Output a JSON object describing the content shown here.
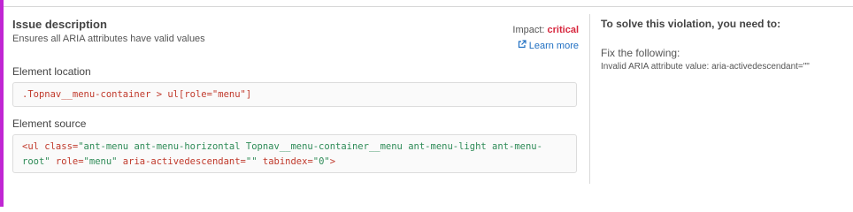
{
  "issue": {
    "title": "Issue description",
    "subtitle": "Ensures all ARIA attributes have valid values",
    "impact_label": "Impact:",
    "impact_value": "critical",
    "learn_more": "Learn more"
  },
  "location": {
    "label": "Element location",
    "selector": ".Topnav__menu-container > ul[role=\"menu\"]"
  },
  "source": {
    "label": "Element source",
    "line1": {
      "t1": "<ul",
      "t2": " class=",
      "t3": "\"ant-menu ant-menu-horizontal Topnav__menu-container__menu ant-menu-light ant-menu-"
    },
    "line2": {
      "t1": "root\"",
      "t2": " role=",
      "t3": "\"menu\"",
      "t4": " aria-activedescendant=",
      "t5": "\"\"",
      "t6": " tabindex=",
      "t7": "\"0\"",
      "t8": ">"
    }
  },
  "solution": {
    "title": "To solve this violation, you need to:",
    "fix_heading": "Fix the following:",
    "fix_detail": "Invalid ARIA attribute value: aria-activedescendant=\"\""
  },
  "colors": {
    "accent": "#c026d3",
    "critical": "#d7263d",
    "link": "#1f6fc2"
  },
  "icons": {
    "learn_more": "external-link-icon"
  }
}
